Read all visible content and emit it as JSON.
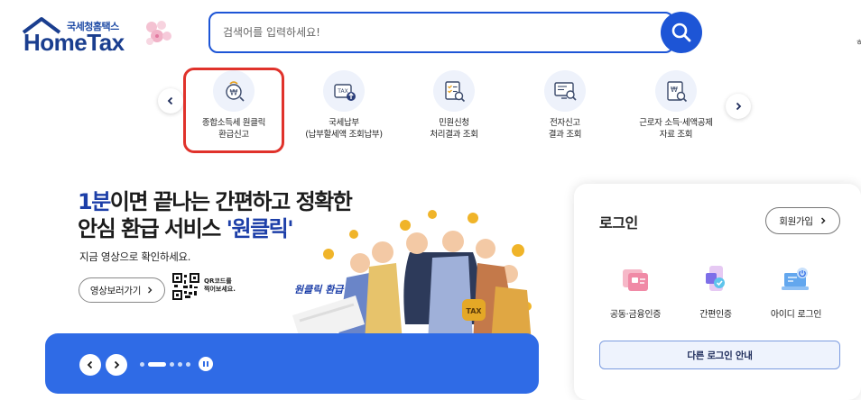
{
  "header": {
    "logo_sub": "국세청홈택스",
    "logo_main": "HomeTax",
    "search_placeholder": "검색어를 입력하세요!",
    "search_icon": "search-icon",
    "edge_mark": "ㅎ"
  },
  "quick_menu": {
    "prev_icon": "chevron-left-icon",
    "next_icon": "chevron-right-icon",
    "items": [
      {
        "line1": "종합소득세 원클릭",
        "line2": "환급신고",
        "icon": "refund-coin-icon",
        "highlighted": true
      },
      {
        "line1": "국세납부",
        "line2": "(납부할세액 조회납부)",
        "icon": "tax-payment-icon"
      },
      {
        "line1": "민원신청",
        "line2": "처리결과 조회",
        "icon": "checklist-search-icon"
      },
      {
        "line1": "전자신고",
        "line2": "결과 조회",
        "icon": "monitor-search-icon"
      },
      {
        "line1": "근로자 소득·세액공제",
        "line2": "자료 조회",
        "icon": "document-search-icon"
      }
    ]
  },
  "banner": {
    "line1_accent": "1분",
    "line1_rest": "이면 끝나는 간편하고 정확한",
    "line2_rest": "안심 환급 서비스 ",
    "line2_accent": "'원클릭'",
    "subtitle": "지금 영상으로 확인하세요.",
    "video_button": "영상보러가기",
    "qr_line1": "QR코드를",
    "qr_line2": "찍어보세요.",
    "art_label": "원클릭 환급",
    "art_bag_label": "TAX",
    "slider_current": 2,
    "slider_total": 5
  },
  "login": {
    "title": "로그인",
    "join_button": "회원가입",
    "options": [
      {
        "label": "공동·금융인증",
        "icon": "certificate-card-icon"
      },
      {
        "label": "간편인증",
        "icon": "mobile-auth-icon"
      },
      {
        "label": "아이디 로그인",
        "icon": "laptop-power-icon"
      }
    ],
    "other_button": "다른 로그인 안내"
  },
  "colors": {
    "brand_blue": "#1d55d6",
    "banner_blue": "#2f6be6",
    "highlight_red": "#e0322b",
    "logo_navy": "#1a3e8f"
  }
}
